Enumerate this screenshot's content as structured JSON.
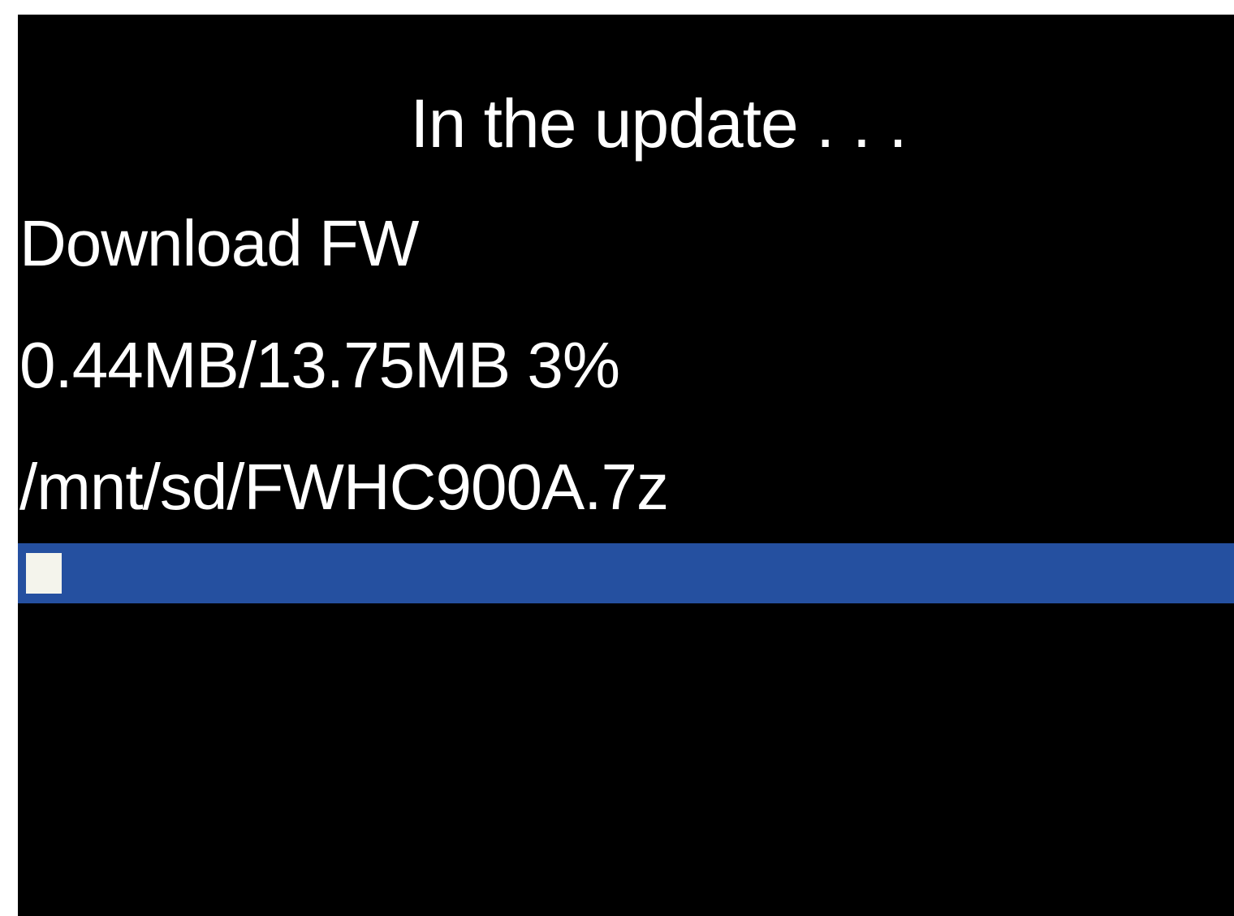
{
  "update_screen": {
    "title": "In the update . . .",
    "status_line": "Download FW",
    "size_progress": "0.44MB/13.75MB 3%",
    "file_path": "/mnt/sd/FWHC900A.7z",
    "progress_fraction": 0.03
  },
  "colors": {
    "background": "#000000",
    "text": "#ffffff",
    "progress_track": "#2550a0",
    "progress_fill": "#f4f4ec"
  }
}
